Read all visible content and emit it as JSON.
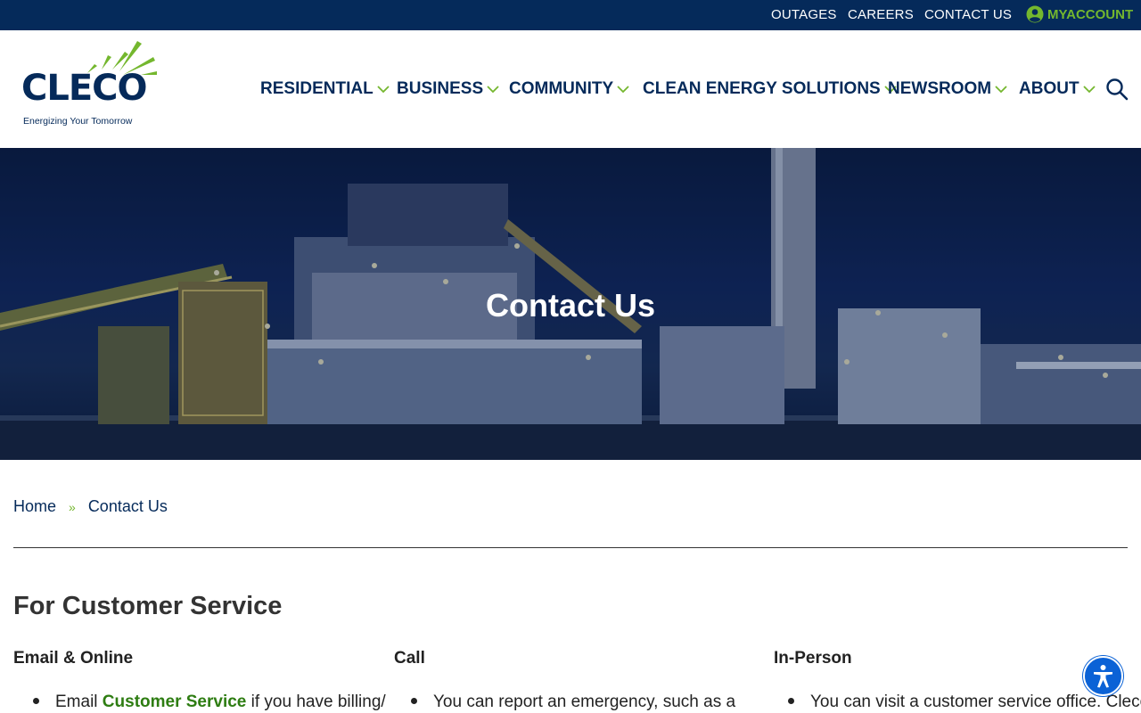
{
  "topbar": {
    "outages": "OUTAGES",
    "careers": "CAREERS",
    "contact": "CONTACT US",
    "myaccount": "MYACCOUNT"
  },
  "logo": {
    "wordmark": "CLECO",
    "tagline": "Energizing Your Tomorrow"
  },
  "nav": {
    "residential": "RESIDENTIAL",
    "business": "BUSINESS",
    "community": "COMMUNITY",
    "clean_energy": "CLEAN ENERGY SOLUTIONS",
    "newsroom": "NEWSROOM",
    "about": "ABOUT"
  },
  "hero": {
    "title": "Contact Us"
  },
  "breadcrumb": {
    "home": "Home",
    "separator": "»",
    "current": "Contact Us"
  },
  "content": {
    "section_title": "For Customer Service",
    "columns": [
      {
        "heading": "Email & Online",
        "item_prefix": "Email ",
        "item_link": "Customer Service",
        "item_suffix": " if you have billing/"
      },
      {
        "heading": "Call",
        "item_text": "You can report an emergency, such as a"
      },
      {
        "heading": "In-Person",
        "item_text": "You can visit a customer service office. Cleco"
      }
    ]
  },
  "colors": {
    "navy": "#052a5a",
    "green": "#74b72e",
    "link_green": "#2e7d12",
    "a11y_blue": "#0b62d6"
  },
  "icons": {
    "account": "account-circle-icon",
    "chevron": "chevron-down-icon",
    "search": "search-icon",
    "accessibility": "accessibility-icon"
  }
}
